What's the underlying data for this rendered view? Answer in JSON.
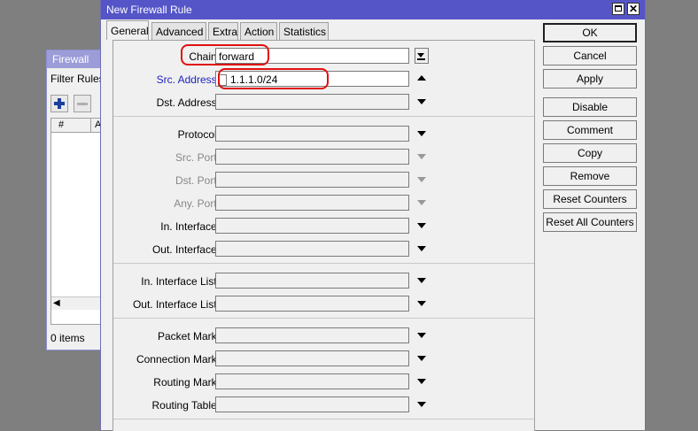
{
  "background_window": {
    "title": "Firewall",
    "tab": "Filter Rules",
    "column_header": "#",
    "column_header2": "A",
    "count": "0 items"
  },
  "dialog": {
    "title": "New Firewall Rule",
    "tabs": [
      {
        "label": "General"
      },
      {
        "label": "Advanced"
      },
      {
        "label": "Extra"
      },
      {
        "label": "Action"
      },
      {
        "label": "Statistics"
      }
    ],
    "fields": {
      "chain": {
        "label": "Chain:",
        "value": "forward"
      },
      "src_address": {
        "label": "Src. Address:",
        "value": "1.1.1.0/24"
      },
      "dst_address": {
        "label": "Dst. Address:"
      },
      "protocol": {
        "label": "Protocol:"
      },
      "src_port": {
        "label": "Src. Port:"
      },
      "dst_port": {
        "label": "Dst. Port:"
      },
      "any_port": {
        "label": "Any. Port:"
      },
      "in_interface": {
        "label": "In. Interface:"
      },
      "out_interface": {
        "label": "Out. Interface:"
      },
      "in_interface_list": {
        "label": "In. Interface List:"
      },
      "out_interface_list": {
        "label": "Out. Interface List:"
      },
      "packet_mark": {
        "label": "Packet Mark:"
      },
      "connection_mark": {
        "label": "Connection Mark:"
      },
      "routing_mark": {
        "label": "Routing Mark:"
      },
      "routing_table": {
        "label": "Routing Table:"
      }
    },
    "buttons": {
      "ok": "OK",
      "cancel": "Cancel",
      "apply": "Apply",
      "disable": "Disable",
      "comment": "Comment",
      "copy": "Copy",
      "remove": "Remove",
      "reset_counters": "Reset Counters",
      "reset_all_counters": "Reset All Counters"
    }
  },
  "colors": {
    "title_bar": "#5555c8",
    "highlight": "#e01010",
    "label_active": "#1f1fbf"
  }
}
